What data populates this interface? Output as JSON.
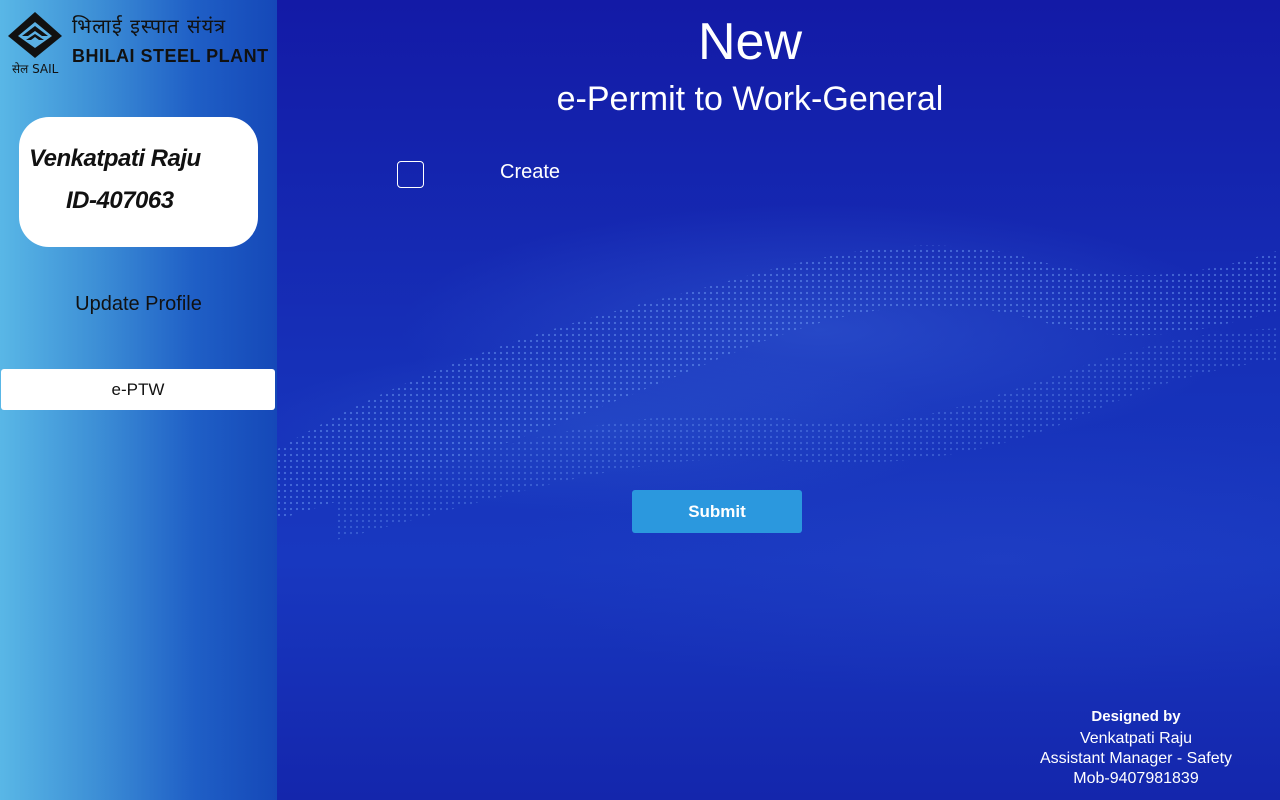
{
  "header": {
    "logo": {
      "hindi_text": "भिलाई  इस्पात  संयंत्र",
      "english_text": "BHILAI STEEL PLANT",
      "sail_text": "सेल SAIL"
    }
  },
  "sidebar": {
    "user": {
      "name": "Venkatpati Raju",
      "id": "ID-407063"
    },
    "update_profile_label": "Update Profile",
    "eptw_label": "e-PTW"
  },
  "main": {
    "title": "New",
    "subtitle": "e-Permit to Work-General",
    "create_checkbox": {
      "label": "Create",
      "checked": false
    },
    "submit_label": "Submit"
  },
  "footer": {
    "designed_by": "Designed by",
    "name": "Venkatpati Raju",
    "designation": "Assistant Manager - Safety",
    "mobile": "Mob-9407981839"
  },
  "colors": {
    "main_bg": "#1420a8",
    "submit_bg": "#2b98de",
    "sidebar_light": "#59b7e6",
    "sidebar_dark": "#1548b8"
  }
}
